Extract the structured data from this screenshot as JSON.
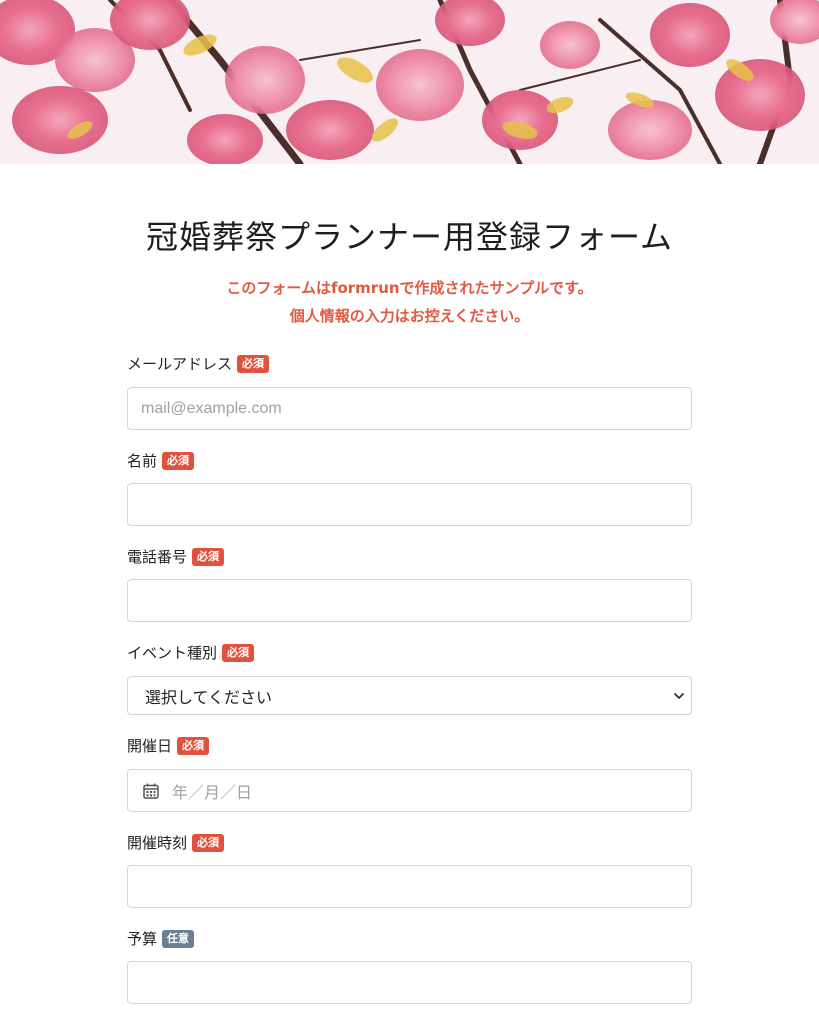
{
  "header": {
    "title": "冠婚葬祭プランナー用登録フォーム",
    "notice_line1": "このフォームはformrunで作成されたサンプルです。",
    "notice_line2": "個人情報の入力はお控えください。"
  },
  "badges": {
    "required": "必須",
    "optional": "任意"
  },
  "fields": {
    "email": {
      "label": "メールアドレス",
      "placeholder": "mail@example.com"
    },
    "name": {
      "label": "名前",
      "placeholder": ""
    },
    "phone": {
      "label": "電話番号",
      "placeholder": ""
    },
    "event_type": {
      "label": "イベント種別",
      "selected": "選択してください"
    },
    "event_date": {
      "label": "開催日",
      "placeholder": "年／月／日"
    },
    "event_time": {
      "label": "開催時刻",
      "placeholder": ""
    },
    "budget": {
      "label": "予算",
      "placeholder": ""
    }
  },
  "colors": {
    "accent": "#e05a42",
    "required_badge": "#e0523e",
    "optional_badge": "#6b7f94"
  },
  "icons": {
    "date": "calendar-icon",
    "select": "chevron-down-icon"
  }
}
